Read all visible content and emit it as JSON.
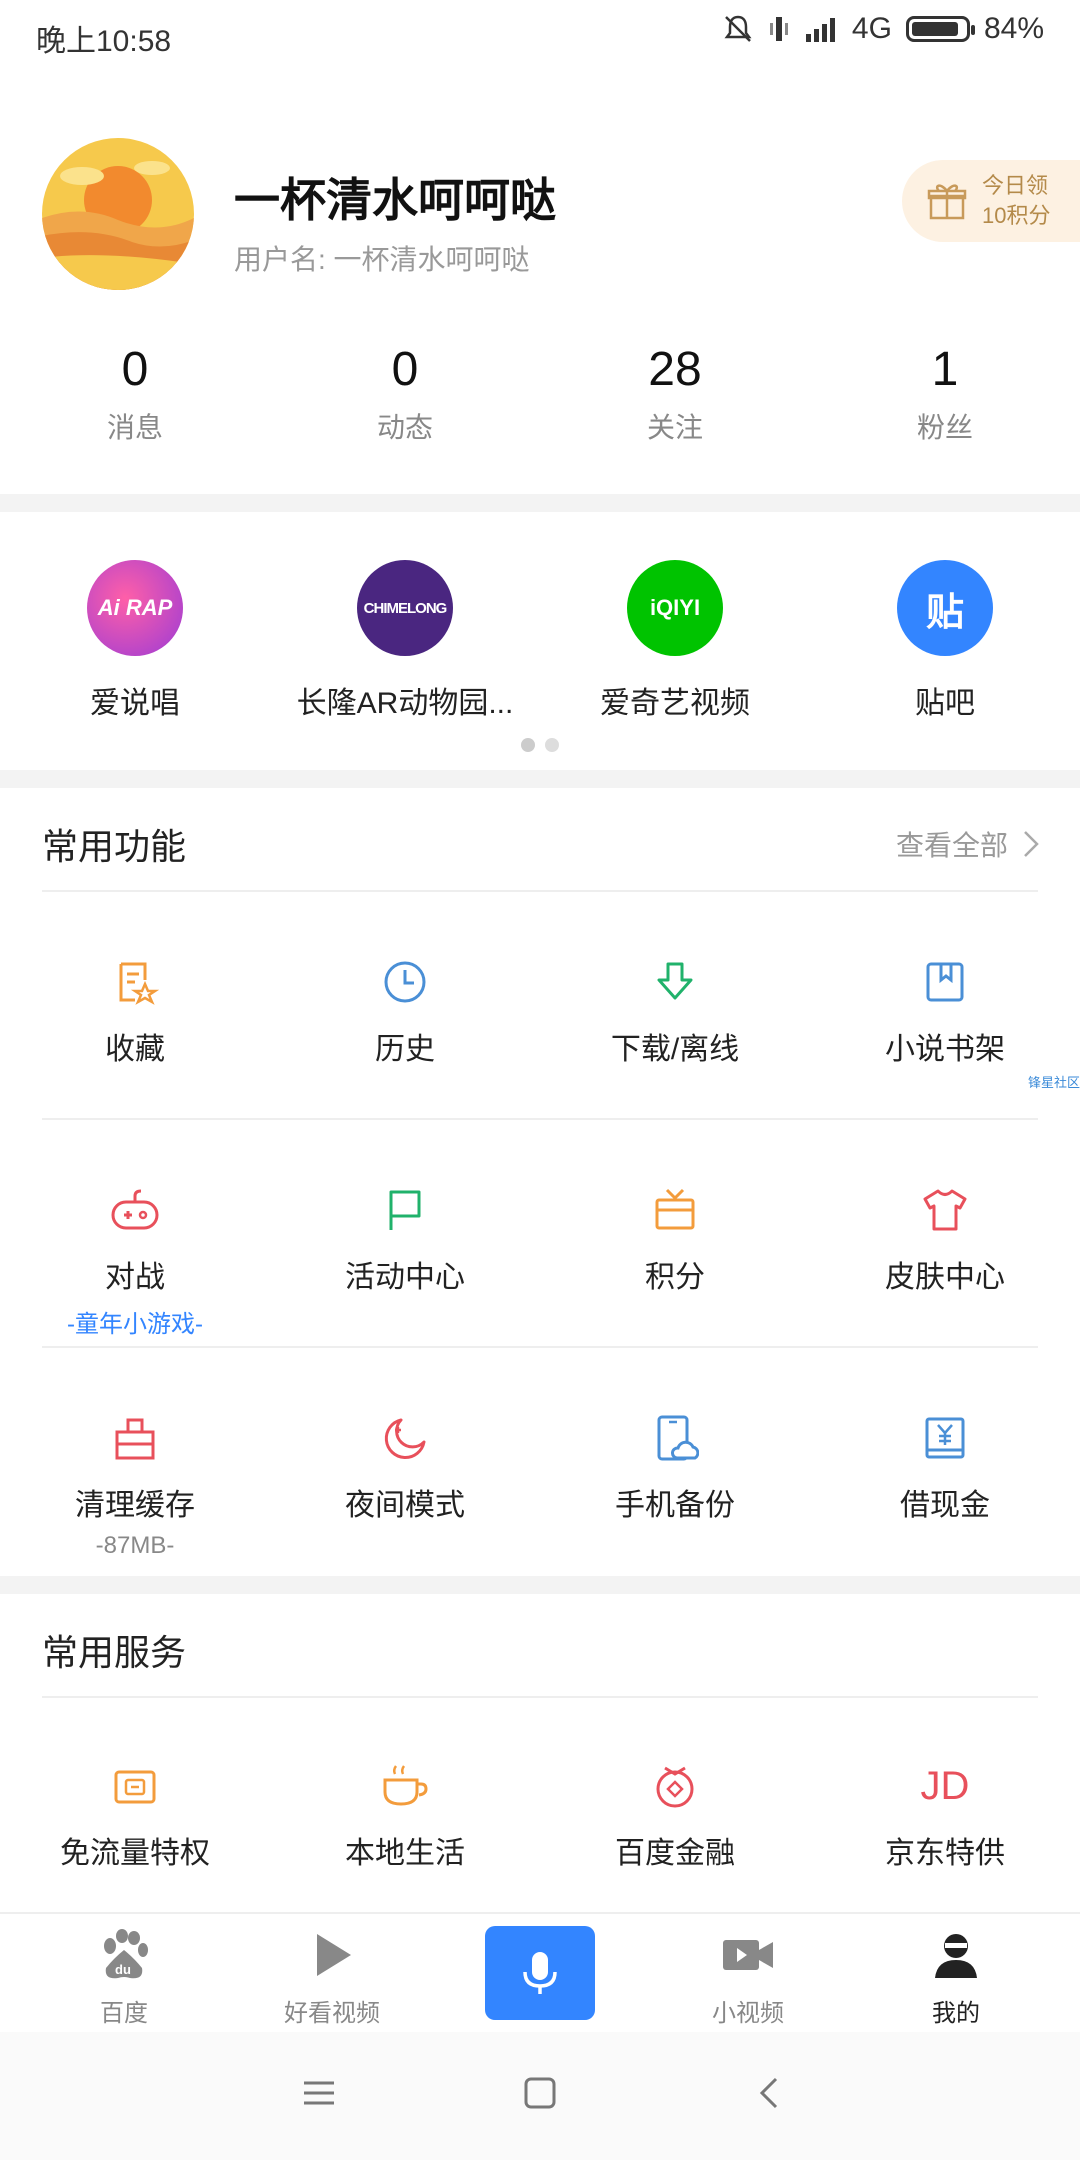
{
  "status": {
    "time": "晚上10:58",
    "network": "4G",
    "battery": "84%"
  },
  "profile": {
    "name": "一杯清水呵呵哒",
    "username": "用户名: 一杯清水呵呵哒",
    "gift_line1": "今日领",
    "gift_line2": "10积分"
  },
  "stats": [
    {
      "value": "0",
      "label": "消息"
    },
    {
      "value": "0",
      "label": "动态"
    },
    {
      "value": "28",
      "label": "关注"
    },
    {
      "value": "1",
      "label": "粉丝"
    }
  ],
  "apps": [
    {
      "name": "爱说唱",
      "icon": "ai-rap-icon",
      "icon_text": "Ai RAP"
    },
    {
      "name": "长隆AR动物园...",
      "icon": "chimelong-icon",
      "icon_text": "CHIMELONG"
    },
    {
      "name": "爱奇艺视频",
      "icon": "iqiyi-icon",
      "icon_text": "iQIYI"
    },
    {
      "name": "贴吧",
      "icon": "tieba-icon",
      "icon_text": "贴"
    }
  ],
  "common_functions": {
    "title": "常用功能",
    "see_all": "查看全部",
    "row1": [
      {
        "label": "收藏",
        "icon": "favorite-icon"
      },
      {
        "label": "历史",
        "icon": "clock-icon"
      },
      {
        "label": "下载/离线",
        "icon": "download-icon"
      },
      {
        "label": "小说书架",
        "icon": "bookshelf-icon"
      }
    ],
    "row2": [
      {
        "label": "对战",
        "icon": "gamepad-icon",
        "sub": "-童年小游戏-"
      },
      {
        "label": "活动中心",
        "icon": "flag-icon"
      },
      {
        "label": "积分",
        "icon": "points-icon"
      },
      {
        "label": "皮肤中心",
        "icon": "shirt-icon"
      }
    ],
    "row3": [
      {
        "label": "清理缓存",
        "icon": "clean-icon",
        "sub": "-87MB-"
      },
      {
        "label": "夜间模式",
        "icon": "moon-icon"
      },
      {
        "label": "手机备份",
        "icon": "phone-backup-icon"
      },
      {
        "label": "借现金",
        "icon": "cash-icon"
      }
    ]
  },
  "watermark": "锋星社区",
  "common_services": {
    "title": "常用服务",
    "items": [
      {
        "label": "免流量特权",
        "icon": "free-data-icon"
      },
      {
        "label": "本地生活",
        "icon": "coffee-icon"
      },
      {
        "label": "百度金融",
        "icon": "finance-icon"
      },
      {
        "label": "京东特供",
        "icon": "jd-icon",
        "icon_text": "JD"
      }
    ]
  },
  "bottom_nav": [
    {
      "label": "百度",
      "icon": "baidu-paw-icon"
    },
    {
      "label": "好看视频",
      "icon": "play-icon"
    },
    {
      "label": "",
      "icon": "mic-icon"
    },
    {
      "label": "小视频",
      "icon": "video-camera-icon"
    },
    {
      "label": "我的",
      "icon": "user-icon"
    }
  ],
  "colors": {
    "accent": "#3385ff",
    "orange": "#f39c3c",
    "red": "#e8505b",
    "green": "#20b26b",
    "blue": "#4a8fd6"
  }
}
